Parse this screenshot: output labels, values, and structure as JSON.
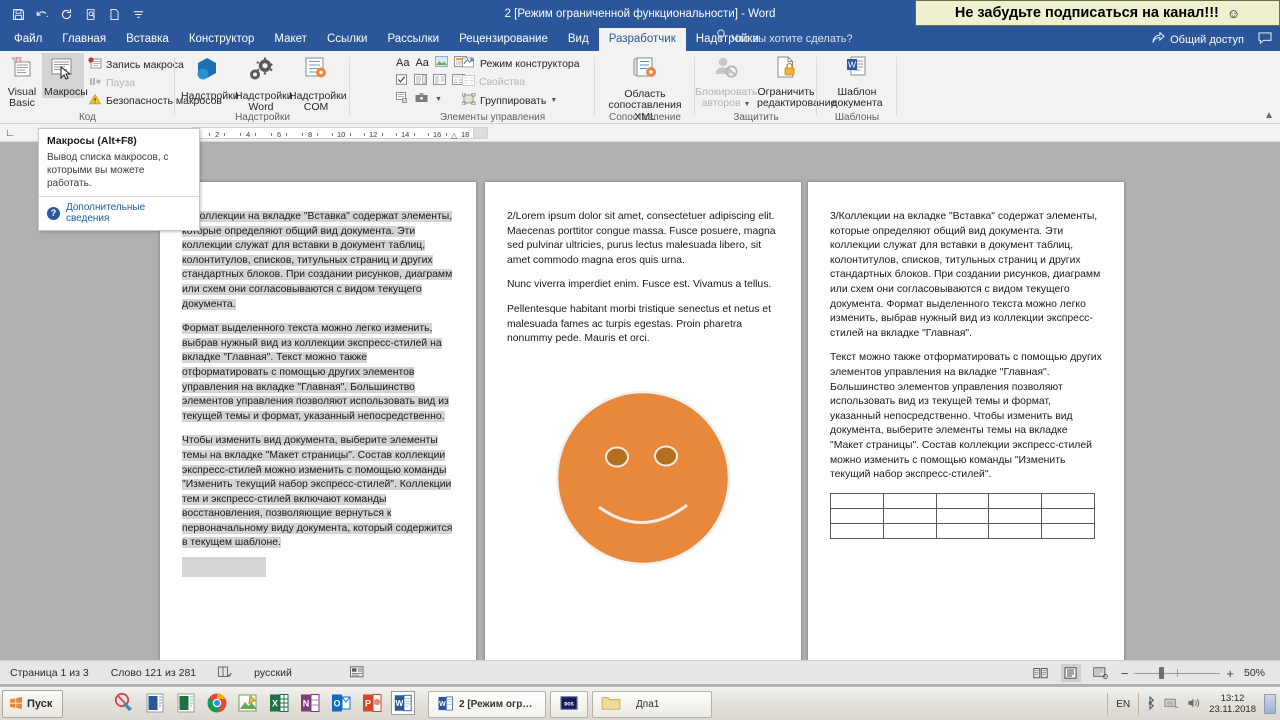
{
  "titlebar": {
    "document_title": "2 [Режим ограниченной функциональности] - Word",
    "qat": [
      "save-icon",
      "undo-icon",
      "redo-icon",
      "print-preview-icon",
      "new-doc-icon",
      "customize-qat-icon"
    ]
  },
  "banner": {
    "text": "Не забудьте подписаться на канал!!!",
    "smiley": "☺",
    "bg": "#eef0cf"
  },
  "tabs": [
    {
      "label": "Файл",
      "active": false
    },
    {
      "label": "Главная",
      "active": false
    },
    {
      "label": "Вставка",
      "active": false
    },
    {
      "label": "Конструктор",
      "active": false
    },
    {
      "label": "Макет",
      "active": false
    },
    {
      "label": "Ссылки",
      "active": false
    },
    {
      "label": "Рассылки",
      "active": false
    },
    {
      "label": "Рецензирование",
      "active": false
    },
    {
      "label": "Вид",
      "active": false
    },
    {
      "label": "Разработчик",
      "active": true
    },
    {
      "label": "Надстройки",
      "active": false
    }
  ],
  "tellme": "Что вы хотите сделать?",
  "titlebar_right": {
    "share": "Общий доступ",
    "comments_icon": "comment-icon"
  },
  "ribbon": {
    "groups": [
      {
        "name": "Код",
        "label": "Код",
        "big_buttons": [
          {
            "label_line1": "Visual",
            "label_line2": "Basic",
            "icon": "visual-basic-icon",
            "selected": false
          },
          {
            "label_line1": "Макросы",
            "label_line2": "",
            "icon": "macros-icon",
            "selected": true
          }
        ],
        "small_buttons": [
          {
            "label": "Запись макроса",
            "icon": "record-macro-icon",
            "disabled": false
          },
          {
            "label": "Пауза",
            "icon": "pause-icon",
            "disabled": true
          },
          {
            "label": "Безопасность макросов",
            "icon": "macro-security-icon",
            "disabled": false
          }
        ]
      },
      {
        "name": "Надстройки",
        "label": "Надстройки",
        "big_buttons": [
          {
            "label_line1": "Надстройки",
            "label_line2": "",
            "icon": "addins-icon",
            "selected": false
          },
          {
            "label_line1": "Надстройки",
            "label_line2": "Word",
            "icon": "word-addins-icon",
            "selected": false
          },
          {
            "label_line1": "Надстройки",
            "label_line2": "COM",
            "icon": "com-addins-icon",
            "selected": false
          }
        ],
        "small_buttons": []
      },
      {
        "name": "Элементы управления",
        "label": "Элементы управления",
        "big_buttons": [],
        "small_buttons": [
          {
            "label": "Режим конструктора",
            "icon": "design-mode-icon",
            "disabled": false
          },
          {
            "label": "Свойства",
            "icon": "properties-icon",
            "disabled": true
          },
          {
            "label": "Группировать",
            "icon": "group-icon",
            "disabled": false
          }
        ]
      },
      {
        "name": "Сопоставление",
        "label": "Сопоставление",
        "big_buttons": [
          {
            "label_line1": "Область",
            "label_line2": "сопоставления XML",
            "icon": "xml-mapping-icon",
            "selected": false
          }
        ],
        "small_buttons": []
      },
      {
        "name": "Защитить",
        "label": "Защитить",
        "big_buttons": [
          {
            "label_line1": "Блокировать",
            "label_line2": "авторов",
            "icon": "block-authors-icon",
            "selected": false,
            "disabled": true
          },
          {
            "label_line1": "Ограничить",
            "label_line2": "редактирование",
            "icon": "restrict-editing-icon",
            "selected": false
          }
        ],
        "small_buttons": []
      },
      {
        "name": "Шаблоны",
        "label": "Шаблоны",
        "big_buttons": [
          {
            "label_line1": "Шаблон",
            "label_line2": "документа",
            "icon": "document-template-icon",
            "selected": false
          }
        ],
        "small_buttons": []
      }
    ]
  },
  "tooltip": {
    "title": "Макросы (Alt+F8)",
    "body": "Вывод списка макросов, с которыми вы можете работать.",
    "more": "Дополнительные сведения"
  },
  "ruler": {
    "ticks": [
      "2",
      "4",
      "6",
      "8",
      "10",
      "12",
      "14",
      "16",
      "18"
    ]
  },
  "document": {
    "page1": {
      "paragraphs": [
        "1/ Коллекции на вкладке \"Вставка\" содержат элементы, которые определяют общий вид документа. Эти коллекции служат для вставки в документ таблиц, колонтитулов, списков, титульных страниц и других стандартных блоков. При создании рисунков, диаграмм или схем они согласовываются с видом текущего документа.",
        "Формат выделенного текста можно легко изменить, выбрав нужный вид из коллекции экспресс-стилей на вкладке \"Главная\". Текст можно также отформатировать с помощью других элементов управления на вкладке \"Главная\". Большинство элементов управления позволяют использовать вид из текущей темы и формат, указанный непосредственно.",
        "Чтобы изменить вид документа, выберите элементы темы на вкладке \"Макет страницы\". Состав коллекции экспресс-стилей можно изменить с помощью команды \"Изменить текущий набор экспресс-стилей\". Коллекции тем и экспресс-стилей включают команды восстановления, позволяющие вернуться к первоначальному виду документа, который содержится в текущем шаблоне."
      ],
      "highlighted": true
    },
    "page2": {
      "paragraphs": [
        "2/Lorem ipsum dolor sit amet, consectetuer adipiscing elit. Maecenas porttitor congue massa. Fusce posuere, magna sed pulvinar ultricies, purus lectus malesuada libero, sit amet commodo magna eros quis urna.",
        "Nunc viverra imperdiet enim. Fusce est. Vivamus a tellus.",
        "Pellentesque habitant morbi tristique senectus et netus et malesuada fames ac turpis egestas. Proin pharetra nonummy pede. Mauris et orci."
      ],
      "image": {
        "name": "smiley-face-image",
        "color": "#e8883a",
        "eye_color": "#b5701f"
      }
    },
    "page3": {
      "paragraphs": [
        "3/Коллекции на вкладке \"Вставка\" содержат элементы, которые определяют общий вид документа. Эти коллекции служат для вставки в документ таблиц, колонтитулов, списков, титульных страниц и других стандартных блоков. При создании рисунков, диаграмм или схем они согласовываются с видом текущего документа. Формат выделенного текста можно легко изменить, выбрав нужный вид из коллекции экспресс-стилей на вкладке \"Главная\".",
        "Текст можно также отформатировать с помощью других элементов управления на вкладке \"Главная\". Большинство элементов управления позволяют использовать вид из текущей темы и формат, указанный непосредственно. Чтобы изменить вид документа, выберите элементы темы на вкладке \"Макет страницы\". Состав коллекции экспресс-стилей можно изменить с помощью команды \"Изменить текущий набор экспресс-стилей\"."
      ],
      "table": {
        "rows": 3,
        "cols": 5
      }
    }
  },
  "statusbar": {
    "page_info": "Страница 1 из 3",
    "word_count": "Слово 121 из 281",
    "proofing_icon": "proofing-icon",
    "language": "русский",
    "accessibility_icon": "accessibility-icon",
    "views": [
      {
        "name": "read-mode-view",
        "active": false
      },
      {
        "name": "print-layout-view",
        "active": true
      },
      {
        "name": "web-layout-view",
        "active": false
      }
    ],
    "zoom_out": "−",
    "zoom_in": "+",
    "zoom_level": "50%"
  },
  "taskbar": {
    "start_label": "Пуск",
    "quick_launch": [
      {
        "name": "antivirus-icon"
      },
      {
        "name": "word-viewer-icon"
      },
      {
        "name": "excel-viewer-icon"
      },
      {
        "name": "chrome-icon"
      },
      {
        "name": "paint-icon"
      },
      {
        "name": "excel-icon"
      },
      {
        "name": "onenote-icon"
      },
      {
        "name": "outlook-icon"
      },
      {
        "name": "powerpoint-icon"
      },
      {
        "name": "word-icon"
      }
    ],
    "tasks": [
      {
        "label": "2 [Режим огранич...",
        "icon": "word-icon",
        "active": true
      },
      {
        "label": "",
        "icon": "dos-icon",
        "active": false
      },
      {
        "label": "Дпа1",
        "icon": "folder-icon",
        "active": false
      }
    ],
    "tray": {
      "language": "EN",
      "icons": [
        "bluetooth-icon",
        "network-icon",
        "volume-icon"
      ],
      "time": "13:12",
      "date": "23.11.2018"
    }
  }
}
